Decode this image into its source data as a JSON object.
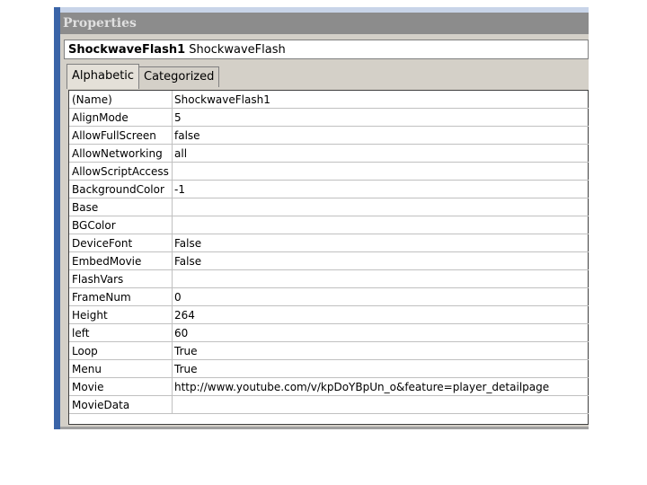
{
  "title": "Properties",
  "object": {
    "name": "ShockwaveFlash1",
    "type": "ShockwaveFlash"
  },
  "tabs": [
    "Alphabetic",
    "Categorized"
  ],
  "properties": [
    {
      "name": "(Name)",
      "value": "ShockwaveFlash1"
    },
    {
      "name": "AlignMode",
      "value": "5"
    },
    {
      "name": "AllowFullScreen",
      "value": "false"
    },
    {
      "name": "AllowNetworking",
      "value": "all"
    },
    {
      "name": "AllowScriptAccess",
      "value": ""
    },
    {
      "name": "BackgroundColor",
      "value": "-1"
    },
    {
      "name": "Base",
      "value": ""
    },
    {
      "name": "BGColor",
      "value": ""
    },
    {
      "name": "DeviceFont",
      "value": "False"
    },
    {
      "name": "EmbedMovie",
      "value": "False"
    },
    {
      "name": "FlashVars",
      "value": ""
    },
    {
      "name": "FrameNum",
      "value": "0"
    },
    {
      "name": "Height",
      "value": "264"
    },
    {
      "name": "left",
      "value": "60"
    },
    {
      "name": "Loop",
      "value": "True"
    },
    {
      "name": "Menu",
      "value": "True"
    },
    {
      "name": "Movie",
      "value": "http://www.youtube.com/v/kpDoYBpUn_o&feature=player_detailpage"
    },
    {
      "name": "MovieData",
      "value": ""
    }
  ]
}
